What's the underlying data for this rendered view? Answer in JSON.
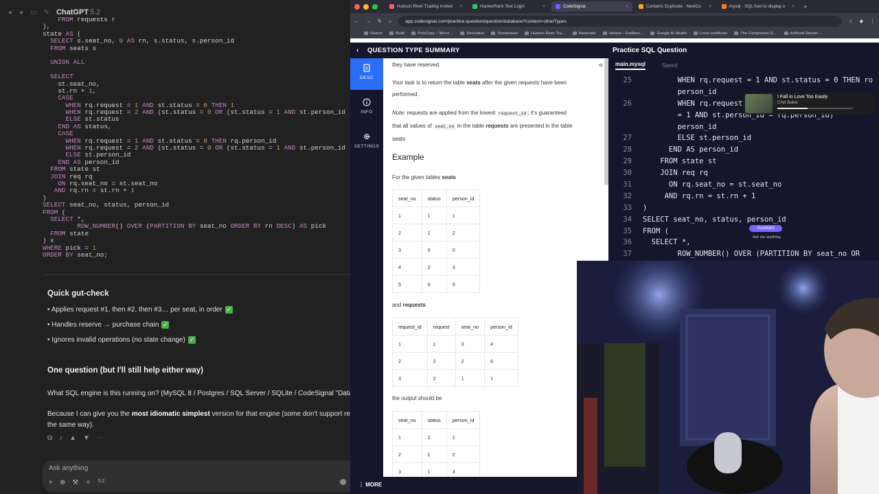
{
  "chatgpt": {
    "model_name": "ChatGPT",
    "model_version": "5.2",
    "code_lines": [
      "    FROM requests r",
      "),",
      "state AS (",
      "  SELECT s.seat_no, 0 AS rn, s.status, s.person_id",
      "  FROM seats s",
      "",
      "  UNION ALL",
      "",
      "  SELECT",
      "    st.seat_no,",
      "    st.rn + 1,",
      "    CASE",
      "      WHEN rq.request = 1 AND st.status = 0 THEN 1",
      "      WHEN rq.request = 2 AND (st.status = 0 OR (st.status = 1 AND st.person_id",
      "      ELSE st.status",
      "    END AS status,",
      "    CASE",
      "      WHEN rq.request = 1 AND st.status = 0 THEN rq.person_id",
      "      WHEN rq.request = 2 AND (st.status = 0 OR (st.status = 1 AND st.person_id",
      "      ELSE st.person_id",
      "    END AS person_id",
      "  FROM state st",
      "  JOIN req rq",
      "    ON rq.seat_no = st.seat_no",
      "   AND rq.rn = st.rn + 1",
      ")",
      "SELECT seat_no, status, person_id",
      "FROM (",
      "  SELECT *,",
      "         ROW_NUMBER() OVER (PARTITION BY seat_no ORDER BY rn DESC) AS pick",
      "  FROM state",
      ") x",
      "WHERE pick = 1",
      "ORDER BY seat_no;"
    ],
    "gut_check_title": "Quick gut-check",
    "bullets": [
      "Applies request #1, then #2, then #3… per seat, in order",
      "Handles reserve → purchase chain",
      "Ignores invalid operations (no state change)"
    ],
    "question_title": "One question (but I'll still help either way)",
    "question_text": "What SQL engine is this running on? (MySQL 8 / Postgres / SQL Server / SQLite / CodeSignal \"Database\"",
    "followup_prefix": "Because I can give you the ",
    "followup_bold": "most idiomatic simplest",
    "followup_suffix": " version for that engine (some don't support recursi",
    "followup_line2": "the same way).",
    "composer_placeholder": "Ask anything",
    "composer_model": "5.2"
  },
  "browser": {
    "tabs": [
      {
        "label": "Hudson River Trading invited",
        "color": "#e66"
      },
      {
        "label": "HackerRank Test Login",
        "color": "#2ec866"
      },
      {
        "label": "CodeSignal",
        "color": "#6a5cff"
      },
      {
        "label": "Contains Duplicate - NeetCo",
        "color": "#f5a623"
      },
      {
        "label": "mysql - SQL how to display o",
        "color": "#f48024"
      }
    ],
    "url": "app.codesignal.com/practice-question/question/database?context=otherTypes",
    "bookmarks": [
      "Search",
      "Build",
      "PolyCopy – Mirror…",
      "Derivative",
      "Streameast",
      "Hudson River Tra…",
      "Neetcode",
      "Variant – Endless…",
      "Google AI Studio",
      "Linux certificate",
      "The Component G…",
      "Artificial Stream –"
    ]
  },
  "codesignal": {
    "header_title": "QUESTION TYPE SUMMARY",
    "practice_title": "Practice SQL Question",
    "nav": [
      {
        "label": "DESC",
        "icon": "document-icon"
      },
      {
        "label": "INFO",
        "icon": "info-icon"
      },
      {
        "label": "SETTINGS",
        "icon": "gear-icon"
      }
    ],
    "more_label": "MORE",
    "desc": {
      "line_top": "they have reserved.",
      "task_prefix": "Your task is to return the table ",
      "task_bold": "seats",
      "task_suffix": " after the given requests have been",
      "task_line2": "performed.",
      "note_label": "Note:",
      "note_text1": " requests are applied from the lowest ",
      "note_code1": "request_id",
      "note_text2": "; it's guaranteed",
      "note_text3": "that all values of ",
      "note_code2": "seat_no",
      "note_text4": " in the table ",
      "note_bold": "requests",
      "note_text5": " are presented in the table",
      "note_line3": "seats",
      "example_title": "Example",
      "given_prefix": "For the given tables ",
      "given_bold": "seats",
      "and_prefix": "and ",
      "and_bold": "requests",
      "output_text": "the output should be"
    },
    "seats_table": {
      "headers": [
        "seat_no",
        "status",
        "person_id"
      ],
      "rows": [
        [
          "1",
          "1",
          "1"
        ],
        [
          "2",
          "1",
          "2"
        ],
        [
          "3",
          "0",
          "0"
        ],
        [
          "4",
          "2",
          "3"
        ],
        [
          "5",
          "0",
          "0"
        ]
      ]
    },
    "requests_table": {
      "headers": [
        "request_id",
        "request",
        "seat_no",
        "person_id"
      ],
      "rows": [
        [
          "1",
          "1",
          "3",
          "4"
        ],
        [
          "2",
          "2",
          "2",
          "5"
        ],
        [
          "3",
          "2",
          "1",
          "1"
        ]
      ]
    },
    "output_table": {
      "headers": [
        "seat_no",
        "status",
        "person_id"
      ],
      "rows": [
        [
          "1",
          "2",
          "1"
        ],
        [
          "2",
          "1",
          "2"
        ],
        [
          "3",
          "1",
          "4"
        ]
      ]
    },
    "editor": {
      "file_tab": "main.mysql",
      "saved_label": "Saved",
      "lines": [
        {
          "n": "25",
          "t": "        WHEN rq.request = 1 AND st.status = 0 THEN ro"
        },
        {
          "n": "",
          "t": "        person_id"
        },
        {
          "n": "26",
          "t": "        WHEN rq.request = 2 AND (st"
        },
        {
          "n": "",
          "t": "        = 1 AND st.person_id = rq.person_id)"
        },
        {
          "n": "",
          "t": "        person_id"
        },
        {
          "n": "27",
          "t": "        ELSE st.person_id"
        },
        {
          "n": "28",
          "t": "      END AS person_id"
        },
        {
          "n": "29",
          "t": "    FROM state st"
        },
        {
          "n": "30",
          "t": "    JOIN req rq"
        },
        {
          "n": "31",
          "t": "      ON rq.seat_no = st.seat_no"
        },
        {
          "n": "32",
          "t": "     AND rq.rn = st.rn + 1"
        },
        {
          "n": "33",
          "t": ")"
        },
        {
          "n": "34",
          "t": "SELECT seat_no, status, person_id"
        },
        {
          "n": "35",
          "t": "FROM ("
        },
        {
          "n": "36",
          "t": "  SELECT *,"
        },
        {
          "n": "37",
          "t": "        ROW_NUMBER() OVER (PARTITION BY seat_no OR"
        }
      ]
    },
    "music": {
      "song": "I Fall in Love Too Easily",
      "artist": "Chet Baker",
      "progress": 0.4
    },
    "ai_pill": "Assistant",
    "ask_me": "Ask me anything"
  }
}
